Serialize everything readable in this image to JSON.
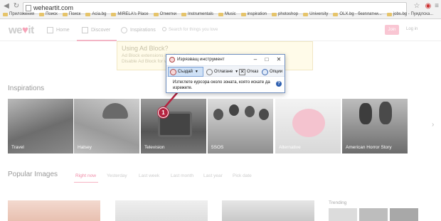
{
  "browser": {
    "url": "weheartit.com",
    "bookmarks": [
      "Приложения",
      "Поиск",
      "Поиск",
      "Acia.bg",
      "MIRELA's Place",
      "Отметки",
      "Instrumentals",
      "Music",
      "inspiration",
      "photoshop",
      "University",
      "OLX.bg - безплатни...",
      "jobs.bg - Пуидлска..."
    ]
  },
  "site": {
    "logo_pre": "we",
    "logo_heart": "♥",
    "logo_post": "it",
    "nav": {
      "home": "Home",
      "discover": "Discover",
      "inspirations": "Inspirations"
    },
    "search_placeholder": "Search for things you love",
    "join": "Join",
    "login": "Log in"
  },
  "adblock": {
    "title": "Using Ad Block?",
    "line1": "Ad Block extensions interfere with our site's look and cause various bugs.",
    "line2": "Disable Ad Block for weheartit.com"
  },
  "inspirations": {
    "title": "Inspirations",
    "tiles": [
      "Travel",
      "Halsey",
      "Television",
      "5SOS",
      "Alternative",
      "American Horror Story"
    ]
  },
  "popular": {
    "title": "Popular Images",
    "tabs": [
      "Right now",
      "Yesterday",
      "Last week",
      "Last month",
      "Last year",
      "Pick date"
    ]
  },
  "trending": "Trending",
  "snipping": {
    "title": "Изрязващ инструмент",
    "new": "Създай",
    "delay": "Отлагане",
    "cancel": "Отказ",
    "options": "Опции",
    "message": "Изтеглете курсора около зоната, която искате да изрежете."
  },
  "annotation": {
    "step": "1",
    "color": "#b4223f"
  }
}
